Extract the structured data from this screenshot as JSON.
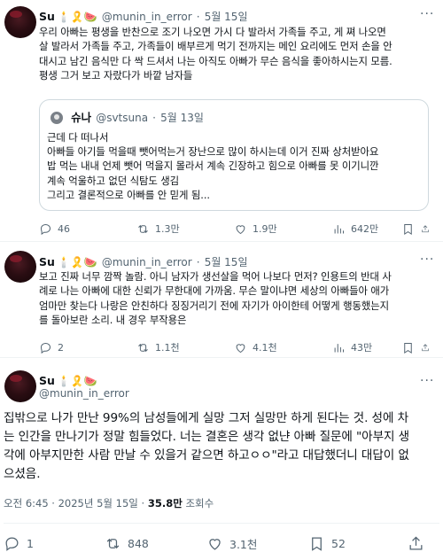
{
  "post1": {
    "name": "Su",
    "emojis": "🕯️🎗️🍉",
    "handle": "@munin_in_error",
    "sep": "·",
    "date": "5월 15일",
    "text": "우리 아빠는 평생을 반찬으로 조기 나오면 가시 다 발라서 가족들 주고, 게 쪄 나오면\n살 발라서 가족들 주고, 가족들이 배부르게 먹기 전까지는 메인 요리에도 먼저 손을 안\n대시고 남긴 음식만 다 싹 드셔서 나는 아직도 아빠가 무슨 음식을 좋아하시는지 모름.\n평생 그거 보고 자랐다가 바깥 남자들",
    "quote": {
      "name": "슈나",
      "handle": "@svtsuna",
      "sep": "·",
      "date": "5월 13일",
      "text": "근데 다 떠나서\n아빠들 아기들 먹을때 뺏어먹는거 장난으로 많이 하시는데 이거 진짜 상처받아요\n밥 먹는 내내 언제 뺏어 먹을지 몰라서 계속 긴장하고 힘으로 아빠를 못 이기니깐\n계속 억울하고 없던 식탐도 생김\n그리고 결론적으로 아빠를 안 믿게 됨..."
    },
    "actions": {
      "replies": "46",
      "reposts": "1.3만",
      "likes": "1.9만",
      "views": "642만"
    }
  },
  "post2": {
    "name": "Su",
    "emojis": "🕯️🎗️🍉",
    "handle": "@munin_in_error",
    "sep": "·",
    "date": "5월 15일",
    "text": "보고 진짜 너무 깜짝 놀람. 아니 남자가 생선살을 먹어 나보다 먼저? 인용트의 반대 사\n례로 나는 아빠에 대한 신뢰가 무한대에 가까움. 무슨 말이냐면 세상의 아빠들아 애가\n엄마만 찾는다 나랑은 안친하다 징징거리기 전에 자기가 아이한테 어떻게 행동했는지\n를 돌아보란 소리. 내 경우 부작용은",
    "actions": {
      "replies": "2",
      "reposts": "1.1천",
      "likes": "4.1천",
      "views": "43만"
    }
  },
  "post3": {
    "name": "Su",
    "emojis": "🕯️🎗️🍉",
    "handle": "@munin_in_error",
    "text": "집밖으로 나가 만난 99%의 남성들에게 실망 그저 실망만 하게 된다는 것. 성에 차\n는 인간을 만나기가 정말 힘들었다. 너는 결혼은 생각 없냔 아빠 질문에 \"아부지 생\n각에 아부지만한 사람 만날 수 있을거 같으면 하고ㅇㅇ\"라고 대답했더니 대답이 없\n으셨음.",
    "timestamp": "오전 6:45 · 2025년 5월 15일 · ",
    "views_count": "35.8만",
    "views_label": " 조회수",
    "actions": {
      "replies": "1",
      "reposts": "848",
      "likes": "3.1천",
      "bookmarks": "52"
    }
  },
  "icons": [
    "more-icon",
    "reply-icon",
    "repost-icon",
    "like-icon",
    "views-icon",
    "bookmark-icon",
    "share-icon"
  ]
}
